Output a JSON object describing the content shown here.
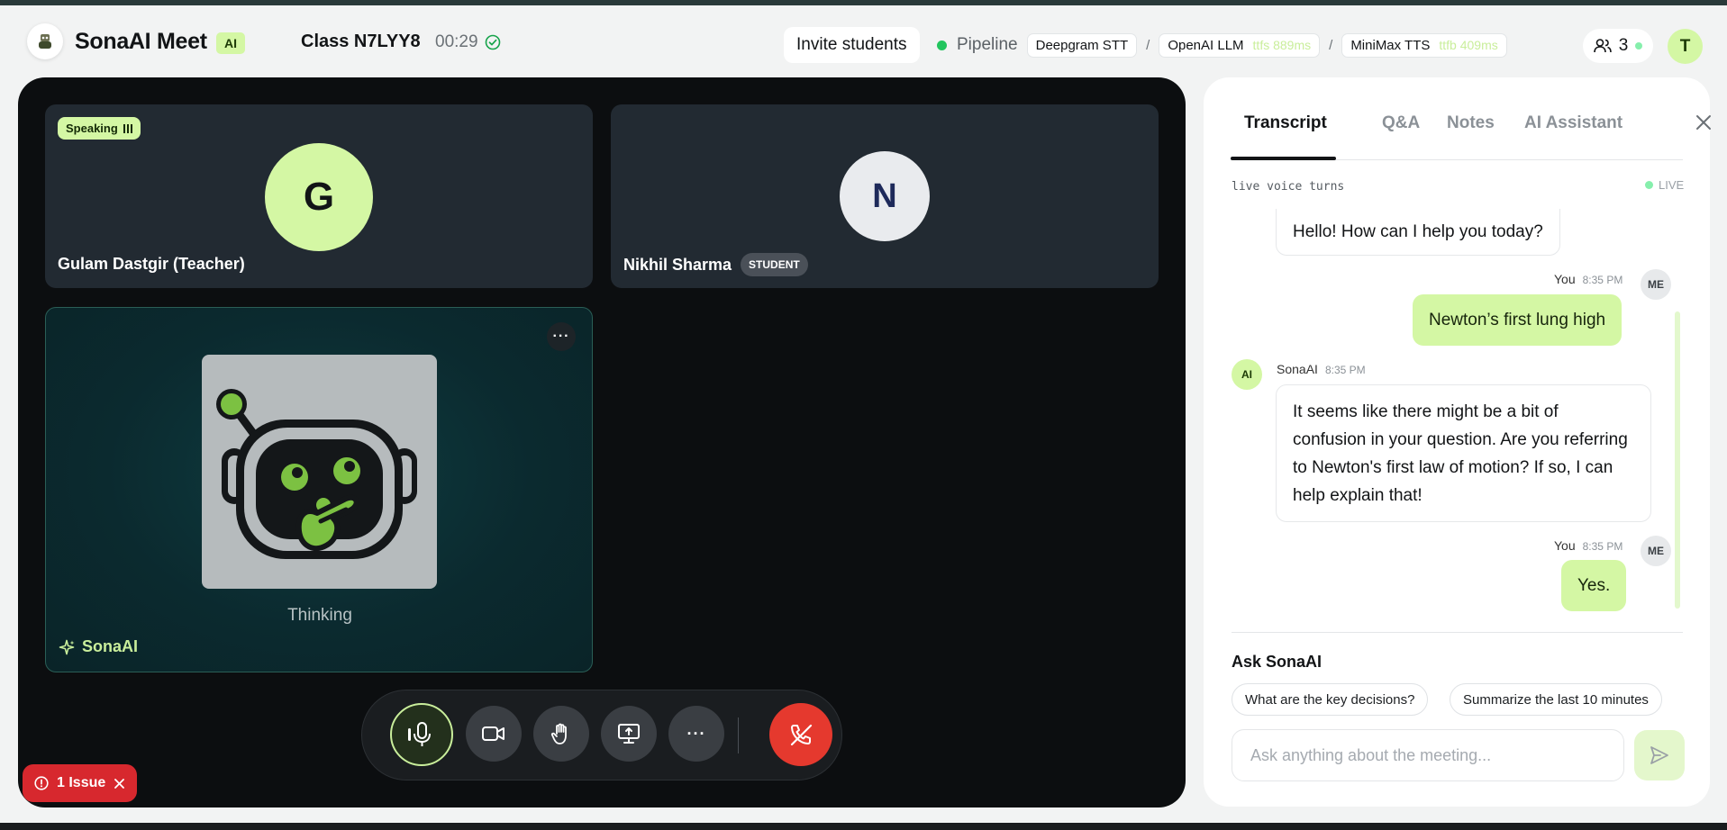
{
  "header": {
    "app_title": "SonaAI Meet",
    "ai_badge": "AI",
    "class_name": "Class N7LYY8",
    "timer": "00:29",
    "invite_label": "Invite students",
    "pipeline_label": "Pipeline",
    "pipeline": [
      {
        "name": "Deepgram STT",
        "latency": ""
      },
      {
        "name": "OpenAI LLM",
        "latency": "ttfs 889ms"
      },
      {
        "name": "MiniMax TTS",
        "latency": "ttfb 409ms"
      }
    ],
    "pipeline_sep": "/",
    "participant_count": "3",
    "user_initial": "T"
  },
  "stage": {
    "teacher": {
      "initial": "G",
      "name": "Gulam Dastgir (Teacher)",
      "speaking_label": "Speaking"
    },
    "student": {
      "initial": "N",
      "name": "Nikhil Sharma",
      "role": "STUDENT"
    },
    "ai": {
      "name": "SonaAI",
      "state": "Thinking",
      "more": "···"
    },
    "controls": {
      "more": "···"
    }
  },
  "issue": {
    "label": "1 Issue"
  },
  "panel": {
    "tabs": [
      "Transcript",
      "Q&A",
      "Notes",
      "AI Assistant"
    ],
    "live_label": "live voice turns",
    "live_tag": "LIVE",
    "messages": [
      {
        "sender": "",
        "time": "",
        "text": "Hello! How can I help you today?"
      },
      {
        "sender": "You",
        "time": "8:35 PM",
        "avatar": "ME",
        "text": "Newton’s first lung high"
      },
      {
        "sender": "SonaAI",
        "time": "8:35 PM",
        "avatar": "AI",
        "text": "It seems like there might be a bit of confusion in your question. Are you referring to Newton's first law of motion? If so, I can help explain that!"
      },
      {
        "sender": "You",
        "time": "8:35 PM",
        "avatar": "ME",
        "text": "Yes."
      }
    ],
    "ask_title": "Ask SonaAI",
    "suggestions": [
      "What are the key decisions?",
      "Summarize the last 10 minutes"
    ],
    "ask_placeholder": "Ask anything about the meeting..."
  },
  "colors": {
    "accent": "#d4f7a4",
    "end_call": "#e5392e",
    "live": "#22c55e",
    "issue": "#d7282e"
  }
}
